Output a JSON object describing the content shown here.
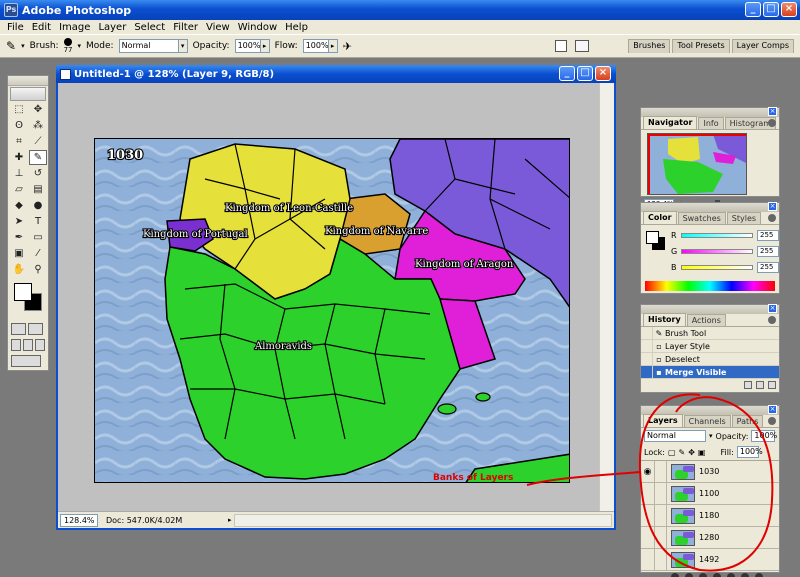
{
  "app": {
    "title": "Adobe Photoshop",
    "logo": "Ps"
  },
  "window_controls": {
    "minimize": "_",
    "maximize": "□",
    "close": "×"
  },
  "menu": [
    "File",
    "Edit",
    "Image",
    "Layer",
    "Select",
    "Filter",
    "View",
    "Window",
    "Help"
  ],
  "options_bar": {
    "brush_label": "Brush:",
    "brush_size": "77",
    "mode_label": "Mode:",
    "mode_value": "Normal",
    "opacity_label": "Opacity:",
    "opacity_value": "100%",
    "flow_label": "Flow:",
    "flow_value": "100%",
    "well_tabs": [
      "Brushes",
      "Tool Presets",
      "Layer Comps"
    ]
  },
  "document": {
    "title": "Untitled-1 @ 128% (Layer 9, RGB/8)",
    "zoom": "128.4%",
    "doc_size": "Doc: 547.0K/4.02M"
  },
  "map": {
    "year": "1030",
    "labels": {
      "leon_castille": "Kingdom of Leon-Castille",
      "portugal": "Kingdom of Portugal",
      "navarre": "Kingdom of Navarre",
      "aragon": "Kingdom of Aragon",
      "almoravids": "Almoravids"
    },
    "colors": {
      "sea": "#8fb0d8",
      "almoravids": "#2cd12c",
      "leon_castille": "#e6e03a",
      "portugal": "#7a2fd0",
      "navarre": "#d9a030",
      "aragon": "#e020d8",
      "east": "#7a5ad8"
    }
  },
  "navigator": {
    "tabs": [
      "Navigator",
      "Info",
      "Histogram"
    ],
    "zoom": "128.4%"
  },
  "color_palette": {
    "tabs": [
      "Color",
      "Swatches",
      "Styles"
    ],
    "r_label": "R",
    "r_value": "255",
    "g_label": "G",
    "g_value": "255",
    "b_label": "B",
    "b_value": "255"
  },
  "history": {
    "tabs": [
      "History",
      "Actions"
    ],
    "items": [
      "Brush Tool",
      "Layer Style",
      "Deselect",
      "Merge Visible"
    ]
  },
  "layers": {
    "tabs": [
      "Layers",
      "Channels",
      "Paths"
    ],
    "blend_mode": "Normal",
    "opacity_label": "Opacity:",
    "opacity_value": "100%",
    "lock_label": "Lock:",
    "fill_label": "Fill:",
    "fill_value": "100%",
    "items": [
      "1030",
      "1100",
      "1180",
      "1280",
      "1492"
    ]
  },
  "annotation": {
    "text": "Banks of Layers",
    "color": "#e00000"
  }
}
